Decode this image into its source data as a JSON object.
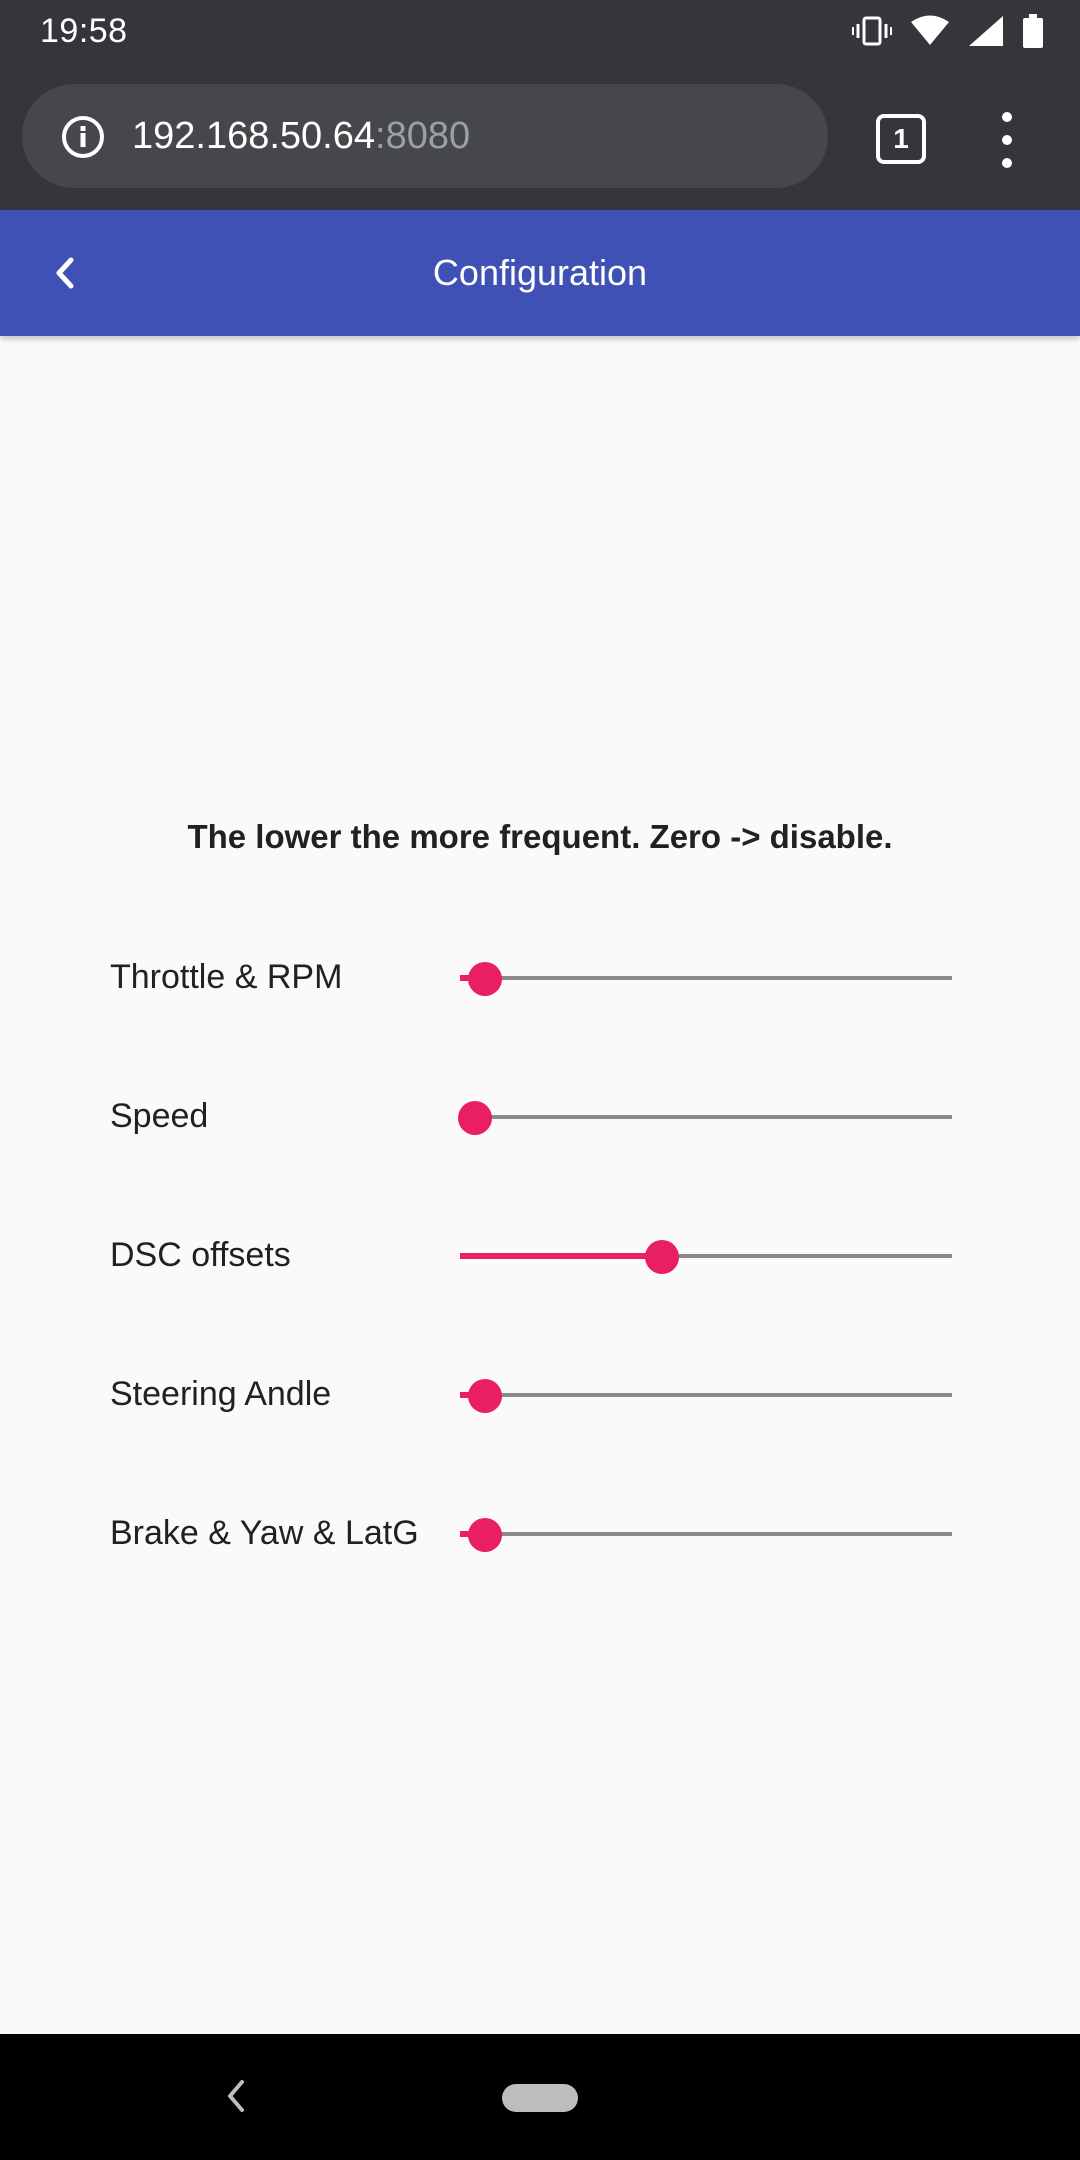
{
  "status_bar": {
    "time": "19:58",
    "icons": [
      "vibrate-icon",
      "wifi-icon",
      "signal-icon",
      "battery-icon"
    ]
  },
  "browser": {
    "url_host": "192.168.50.64",
    "url_port": ":8080",
    "tab_count": "1",
    "icons": [
      "info-icon",
      "more-vert-icon"
    ]
  },
  "app_bar": {
    "title": "Configuration",
    "back_icon": "chevron-left-icon",
    "color": "#3f51b5"
  },
  "content": {
    "hint": "The lower the more frequent. Zero -> disable.",
    "accent_color": "#e91e63",
    "sliders": [
      {
        "label": "Throttle & RPM",
        "value_fraction": 0.05
      },
      {
        "label": "Speed",
        "value_fraction": 0.03
      },
      {
        "label": "DSC offsets",
        "value_fraction": 0.41
      },
      {
        "label": "Steering Andle",
        "value_fraction": 0.05
      },
      {
        "label": "Brake & Yaw & LatG",
        "value_fraction": 0.05
      }
    ]
  },
  "nav_bar": {
    "icons": [
      "back-icon",
      "home-pill"
    ]
  }
}
